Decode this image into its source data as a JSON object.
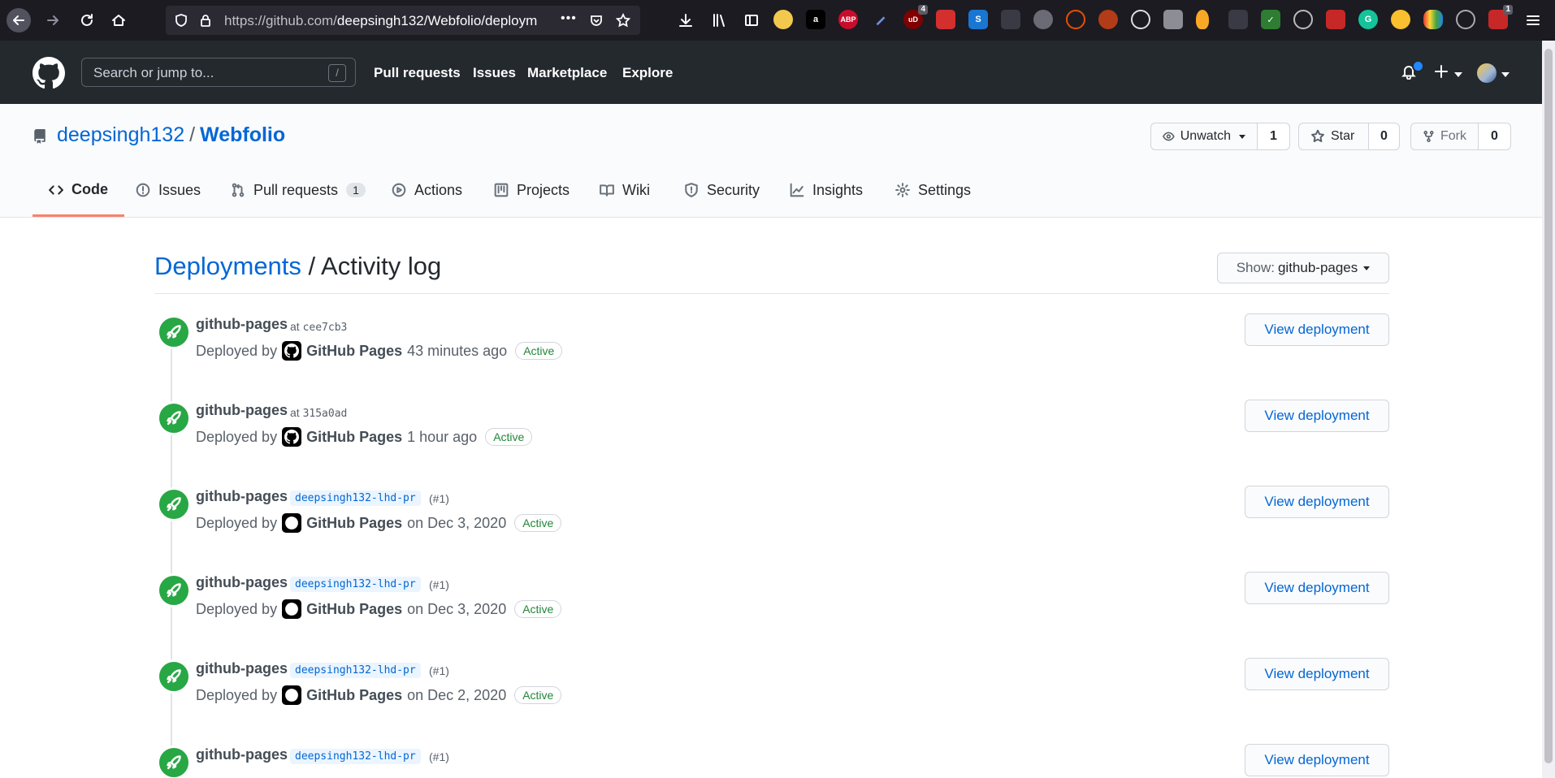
{
  "browser": {
    "url_prefix": "https://github.com/",
    "url_rest": "deepsingh132/Webfolio/deploym",
    "more": "•••",
    "ext_badges": {
      "ublock": "4",
      "last": "1"
    },
    "ext_labels": {
      "abp": "ABP",
      "amazon": "a",
      "ublock": "uD"
    }
  },
  "header": {
    "search_placeholder": "Search or jump to...",
    "search_shortcut": "/",
    "nav": [
      "Pull requests",
      "Issues",
      "Marketplace",
      "Explore"
    ]
  },
  "repo": {
    "owner": "deepsingh132",
    "separator": "/",
    "name": "Webfolio",
    "unwatch_label": "Unwatch",
    "unwatch_count": "1",
    "star_label": "Star",
    "star_count": "0",
    "fork_label": "Fork",
    "fork_count": "0"
  },
  "tabs": [
    {
      "label": "Code"
    },
    {
      "label": "Issues"
    },
    {
      "label": "Pull requests",
      "counter": "1"
    },
    {
      "label": "Actions"
    },
    {
      "label": "Projects"
    },
    {
      "label": "Wiki"
    },
    {
      "label": "Security"
    },
    {
      "label": "Insights"
    },
    {
      "label": "Settings"
    }
  ],
  "main": {
    "title_link": "Deployments",
    "title_rest": "/ Activity log",
    "show_label": "Show:",
    "show_value": "github-pages"
  },
  "deployments": [
    {
      "env": "github-pages",
      "at": "at",
      "sha": "cee7cb3",
      "deployed_by": "Deployed by",
      "actor": "GitHub Pages",
      "time": "43 minutes ago",
      "status": "Active",
      "button": "View deployment"
    },
    {
      "env": "github-pages",
      "at": "at",
      "sha": "315a0ad",
      "deployed_by": "Deployed by",
      "actor": "GitHub Pages",
      "time": "1 hour ago",
      "status": "Active",
      "button": "View deployment"
    },
    {
      "env": "github-pages",
      "ref": "deepsingh132-lhd-pr",
      "pr": "(#1)",
      "deployed_by": "Deployed by",
      "actor": "GitHub Pages",
      "time": "on Dec 3, 2020",
      "status": "Active",
      "button": "View deployment"
    },
    {
      "env": "github-pages",
      "ref": "deepsingh132-lhd-pr",
      "pr": "(#1)",
      "deployed_by": "Deployed by",
      "actor": "GitHub Pages",
      "time": "on Dec 3, 2020",
      "status": "Active",
      "button": "View deployment"
    },
    {
      "env": "github-pages",
      "ref": "deepsingh132-lhd-pr",
      "pr": "(#1)",
      "deployed_by": "Deployed by",
      "actor": "GitHub Pages",
      "time": "on Dec 2, 2020",
      "status": "Active",
      "button": "View deployment"
    },
    {
      "env": "github-pages",
      "ref": "deepsingh132-lhd-pr",
      "pr": "(#1)",
      "button": "View deployment"
    }
  ],
  "colors": {
    "header_bg": "#24292e",
    "link": "#0366d6",
    "success": "#28a745",
    "active_text": "#22863a",
    "tab_underline": "#f9826c"
  }
}
